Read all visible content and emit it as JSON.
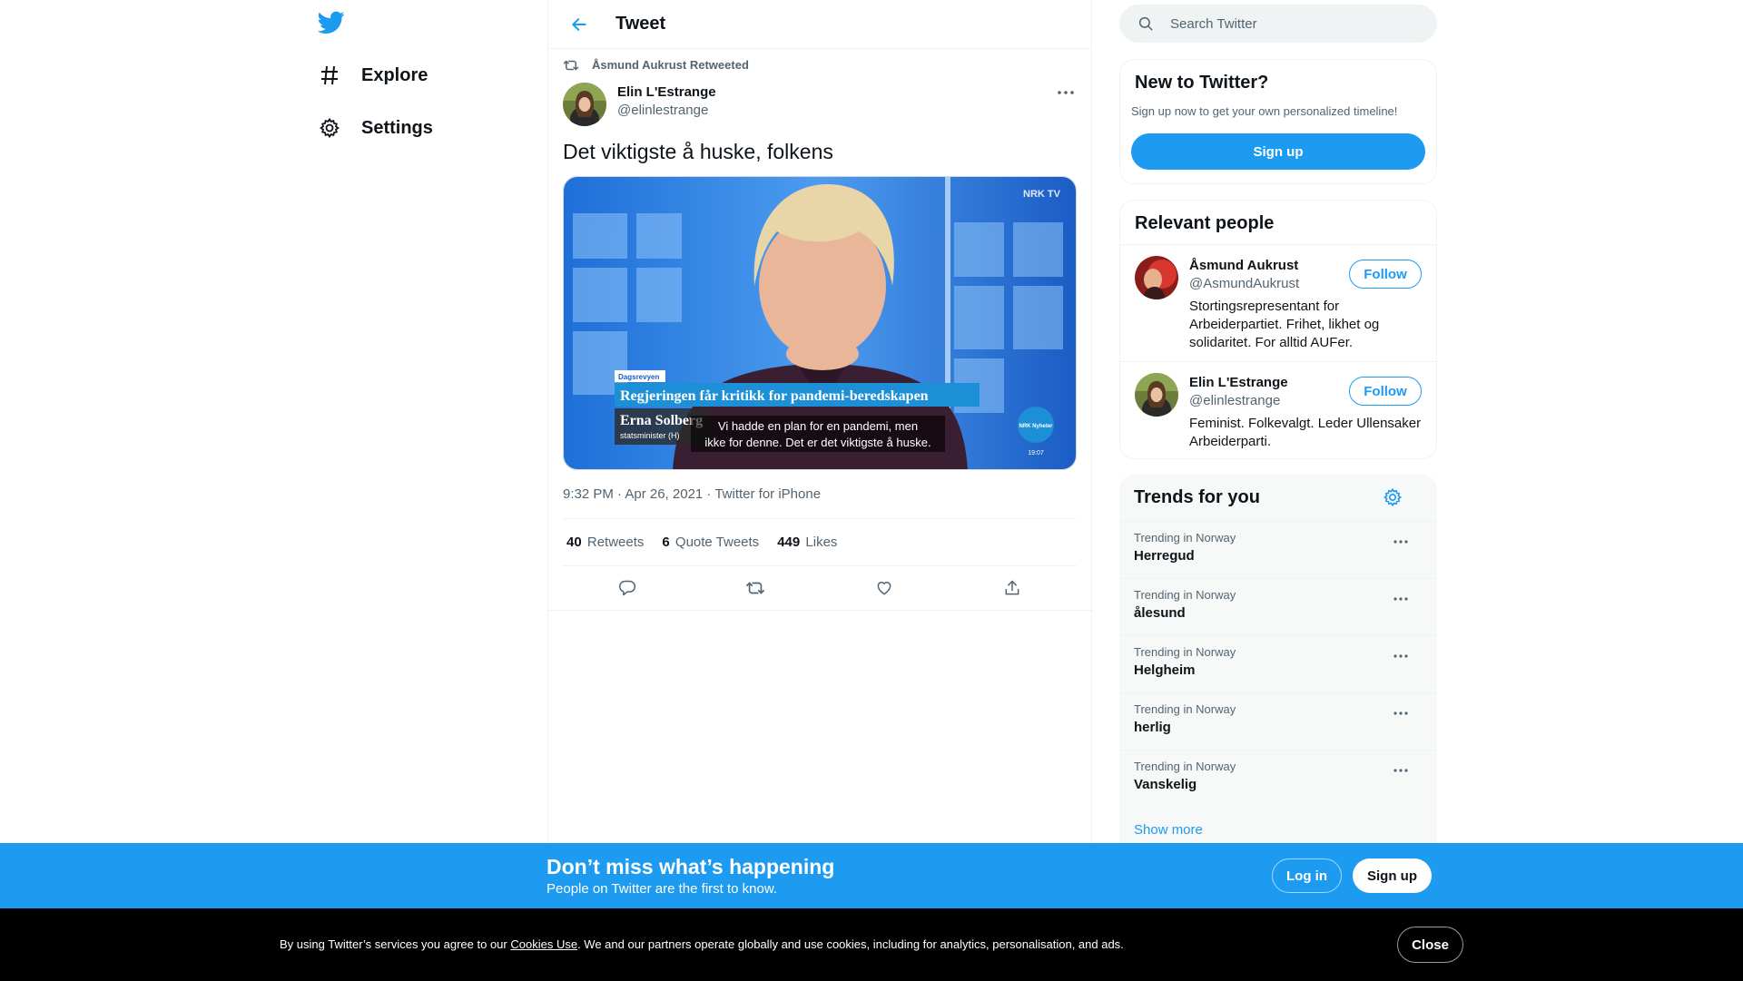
{
  "nav": {
    "items": [
      {
        "label": "Explore",
        "icon": "hashtag-icon"
      },
      {
        "label": "Settings",
        "icon": "gear-icon"
      }
    ]
  },
  "header": {
    "title": "Tweet"
  },
  "tweet": {
    "retweeted_by": "Åsmund Aukrust Retweeted",
    "author_name": "Elin L'Estrange",
    "author_handle": "@elinlestrange",
    "text": "Det viktigste å huske, folkens",
    "media": {
      "badge_top": "NRK TV",
      "program": "Dagsrevyen",
      "headline": "Regjeringen får kritikk for pandemi-beredskapen",
      "person_name": "Erna Solberg",
      "person_role": "statsminister (H)",
      "subtitle_1": "Vi hadde en plan for en pandemi, men",
      "subtitle_2": "ikke for denne. Det er det viktigste å huske.",
      "channel_logo": "NRK Nyheter",
      "clock": "19:07"
    },
    "timestamp": "9:32 PM · Apr 26, 2021 · Twitter for iPhone",
    "stats": [
      {
        "count": "40",
        "label": "Retweets"
      },
      {
        "count": "6",
        "label": "Quote Tweets"
      },
      {
        "count": "449",
        "label": "Likes"
      }
    ]
  },
  "search": {
    "placeholder": "Search Twitter"
  },
  "new_to_twitter": {
    "title": "New to Twitter?",
    "subtitle": "Sign up now to get your own personalized timeline!",
    "button": "Sign up"
  },
  "relevant_people": {
    "title": "Relevant people",
    "people": [
      {
        "name": "Åsmund Aukrust",
        "handle": "@AsmundAukrust",
        "bio": "Stortingsrepresentant for Arbeiderpartiet. Frihet, likhet og solidaritet. For alltid AUFer.",
        "follow": "Follow"
      },
      {
        "name": "Elin L'Estrange",
        "handle": "@elinlestrange",
        "bio": "Feminist. Folkevalgt. Leder Ullensaker Arbeiderparti.",
        "follow": "Follow"
      }
    ]
  },
  "trends": {
    "title": "Trends for you",
    "items": [
      {
        "context": "Trending in Norway",
        "name": "Herregud"
      },
      {
        "context": "Trending in Norway",
        "name": "ålesund"
      },
      {
        "context": "Trending in Norway",
        "name": "Helgheim"
      },
      {
        "context": "Trending in Norway",
        "name": "herlig"
      },
      {
        "context": "Trending in Norway",
        "name": "Vanskelig"
      }
    ],
    "show_more": "Show more"
  },
  "banner": {
    "title": "Don’t miss what’s happening",
    "subtitle": "People on Twitter are the first to know.",
    "login": "Log in",
    "signup": "Sign up"
  },
  "cookie": {
    "text_before": "By using Twitter’s services you agree to our ",
    "link": "Cookies Use",
    "text_after": ". We and our partners operate globally and use cookies, including for analytics, personalisation, and ads.",
    "close": "Close"
  },
  "colors": {
    "accent": "#1d9bf0",
    "text": "#0f1419",
    "muted": "#536471"
  }
}
